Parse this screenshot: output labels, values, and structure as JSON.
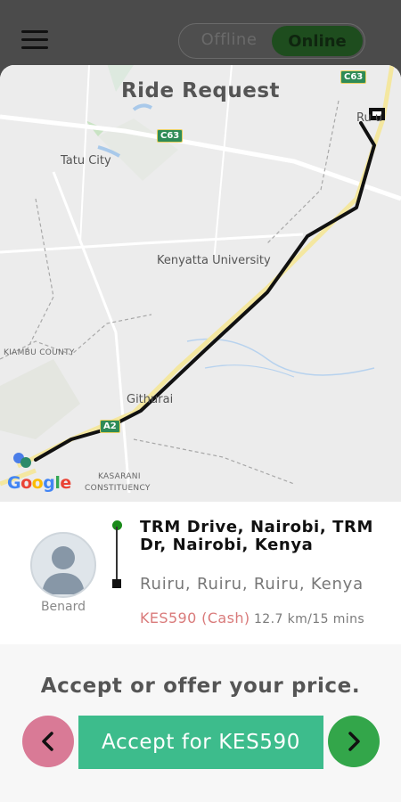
{
  "header": {
    "status_toggle": {
      "offline_label": "Offline",
      "online_label": "Online",
      "selected": "Online"
    }
  },
  "modal": {
    "title": "Ride Request",
    "map": {
      "labels": {
        "tatu_city": "Tatu City",
        "kenyatta_university": "Kenyatta University",
        "githurai": "Githurai",
        "kiambu_county": "KIAMBU COUNTY",
        "kasarani_line1": "KASARANI",
        "kasarani_line2": "CONSTITUENCY",
        "ruiru": "Ru u",
        "road_c63": "C63",
        "road_c63_top": "C63",
        "road_a2": "A2"
      },
      "provider_logo": "Google"
    },
    "rider": {
      "name": "Benard",
      "avatar_icon": "user-avatar-icon"
    },
    "trip": {
      "pickup": "TRM Drive, Nairobi, TRM Dr, Nairobi, Kenya",
      "dropoff": "Ruiru, Ruiru, Ruiru, Kenya",
      "price": "KES590 (Cash)",
      "distance_time": "12.7 km/15 mins"
    },
    "prompt": "Accept or offer your price.",
    "buttons": {
      "prev_icon": "chevron-left-icon",
      "accept_label": "Accept for KES590",
      "next_icon": "chevron-right-icon"
    }
  },
  "colors": {
    "accept": "#3dbc8c",
    "prev": "#d97a96",
    "next": "#33a64a",
    "online": "#1e4d1e",
    "price": "#d97a7a",
    "route": "#111111"
  }
}
